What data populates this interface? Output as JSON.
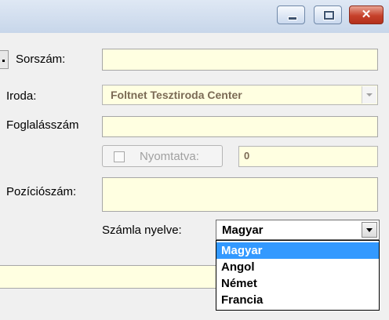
{
  "window": {
    "minimize_icon": "minimize-icon",
    "maximize_icon": "maximize-icon",
    "close_icon": "close-icon",
    "close_glyph": "✕"
  },
  "form": {
    "sorszam_label": "Sorszám:",
    "sorszam_value": "",
    "iroda_label": "Iroda:",
    "iroda_value": "Foltnet Tesztiroda Center",
    "foglalasszam_label": "Foglalásszám",
    "foglalasszam_value": "",
    "nyomtatva_label": "Nyomtatva:",
    "nyomtatva_checked": false,
    "nyomtatva_value": "0",
    "poziciosszam_label": "Pozíciószám:",
    "poziciosszam_value": "",
    "szamla_nyelve_label": "Számla nyelve:",
    "szamla_nyelve_value": "Magyar",
    "language_options": [
      "Magyar",
      "Angol",
      "Német",
      "Francia"
    ],
    "selected_option_index": 0
  },
  "colors": {
    "field_bg": "#ffffe1",
    "selection": "#3399ff",
    "window_bg": "#f0f0f0"
  }
}
